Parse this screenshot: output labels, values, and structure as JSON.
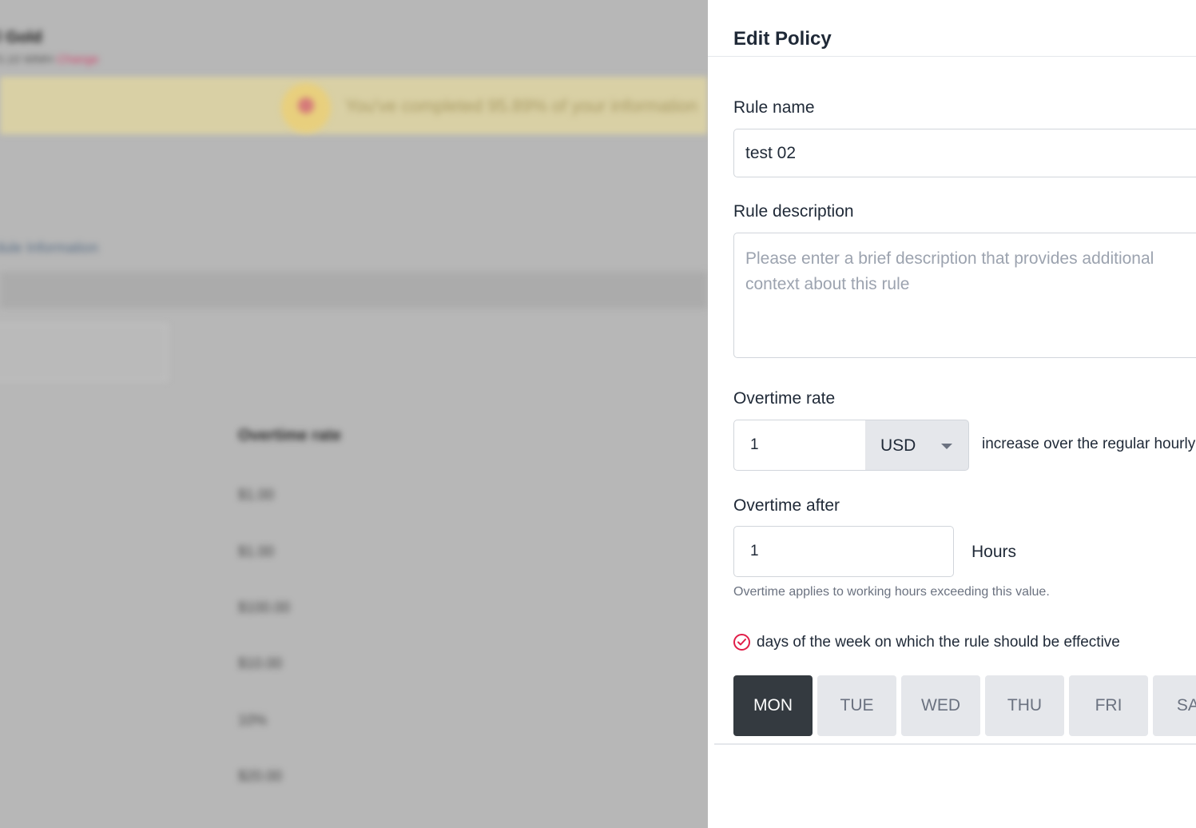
{
  "background": {
    "title": "l Gold",
    "subtitle": "5.10 WMH",
    "subtitle_link": "Change",
    "banner_text": "You've completed 95.89% of your information",
    "section_link": "dule Information",
    "column_header": "Overtime rate",
    "column_values": [
      "$1.00",
      "$1.00",
      "$100.00",
      "$10.00",
      "10%",
      "$20.00"
    ]
  },
  "drawer": {
    "title": "Edit Policy",
    "rule_name": {
      "label": "Rule name",
      "value": "test 02"
    },
    "rule_description": {
      "label": "Rule description",
      "placeholder": "Please enter a brief description that provides additional context about this rule"
    },
    "overtime_rate": {
      "label": "Overtime rate",
      "value": "1",
      "currency": "USD",
      "suffix": "increase over the regular hourly rate"
    },
    "overtime_after": {
      "label": "Overtime after",
      "value": "1",
      "unit": "Hours",
      "helper": "Overtime applies to working hours exceeding this value."
    },
    "days_checkbox": {
      "label": "days of the week on which the rule should be effective",
      "checked": true,
      "icon": "check-icon",
      "color": "#e11d48"
    },
    "days": [
      {
        "label": "MON",
        "active": true
      },
      {
        "label": "TUE",
        "active": false
      },
      {
        "label": "WED",
        "active": false
      },
      {
        "label": "THU",
        "active": false
      },
      {
        "label": "FRI",
        "active": false
      },
      {
        "label": "SAT",
        "active": false
      }
    ]
  }
}
